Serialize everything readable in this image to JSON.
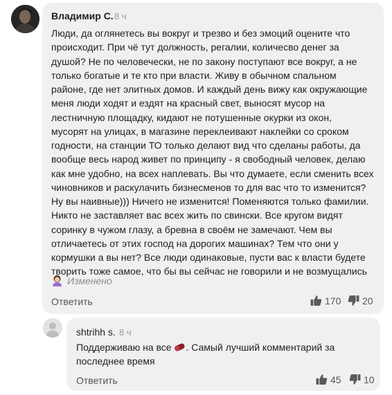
{
  "main_comment": {
    "author": "Владимир С.",
    "time": "8 ч",
    "lines": [
      "Люди, да оглянетесь вы вокруг и трезво и без эмоций оцените что",
      "происходит. При чё тут должность, регалии, количесво денег за",
      "душой? Не  по человечески, не по закону поступают все вокруг, а не",
      "только богатые и те кто при власти. Живу в обычном спальном",
      "районе, где нет элитных домов. И каждый день вижу как окружающие",
      "меня люди ходят и ездят на красный свет, выносят мусор на",
      "лестничную площадку, кидают не потушенные окурки из окон,",
      "мусорят на улицах, в магазине переклеивают наклейки со сроком",
      "годности, на станции ТО только делают вид что сделаны работы, да",
      "вообще весь народ живет по принципу - я свободный человек, делаю",
      "как мне удобно, на всех наплевать. Вы что думаете, если сменить всех",
      "чиновников и раскулачить бизнесменов то для вас что то изменится?",
      "Ну вы наивные))) Ничего не изменится! Поменяются только фамилии.",
      "Никто не заставляет вас всех жить по свински. Все кругом видят",
      "соринку в чужом глазу, а бревна в своём не замечают. Чем вы",
      "отличаетесь от этих господ на дорогих машинах? Тем что они у",
      "кормушки а вы нет? Все люди одинаковые, пусти вас к власти будете",
      "творить тоже самое, что бы вы сейчас не говорили и не возмущались"
    ],
    "edited_label": "Изменено",
    "reply_label": "Ответить",
    "likes": "170",
    "dislikes": "20"
  },
  "reply_comment": {
    "author": "shtrihh s.",
    "time": "8 ч",
    "text_before_emoji": "Поддерживаю на все ",
    "text_after_emoji": ". Самый лучший комментарий за",
    "text_line2": "последнее время",
    "reply_label": "Ответить",
    "likes": "45",
    "dislikes": "10"
  },
  "icons": {
    "avatar_main": "user-photo",
    "avatar_reply": "default-user-silhouette",
    "edited_emoji": "woman-emoji",
    "reply_emoji": "pill-emoji",
    "like": "thumbs-up-icon",
    "dislike": "thumbs-down-icon"
  },
  "colors": {
    "bubble": "#f0f0f0",
    "muted": "#8d8d8d",
    "text": "#1f1f1f"
  }
}
